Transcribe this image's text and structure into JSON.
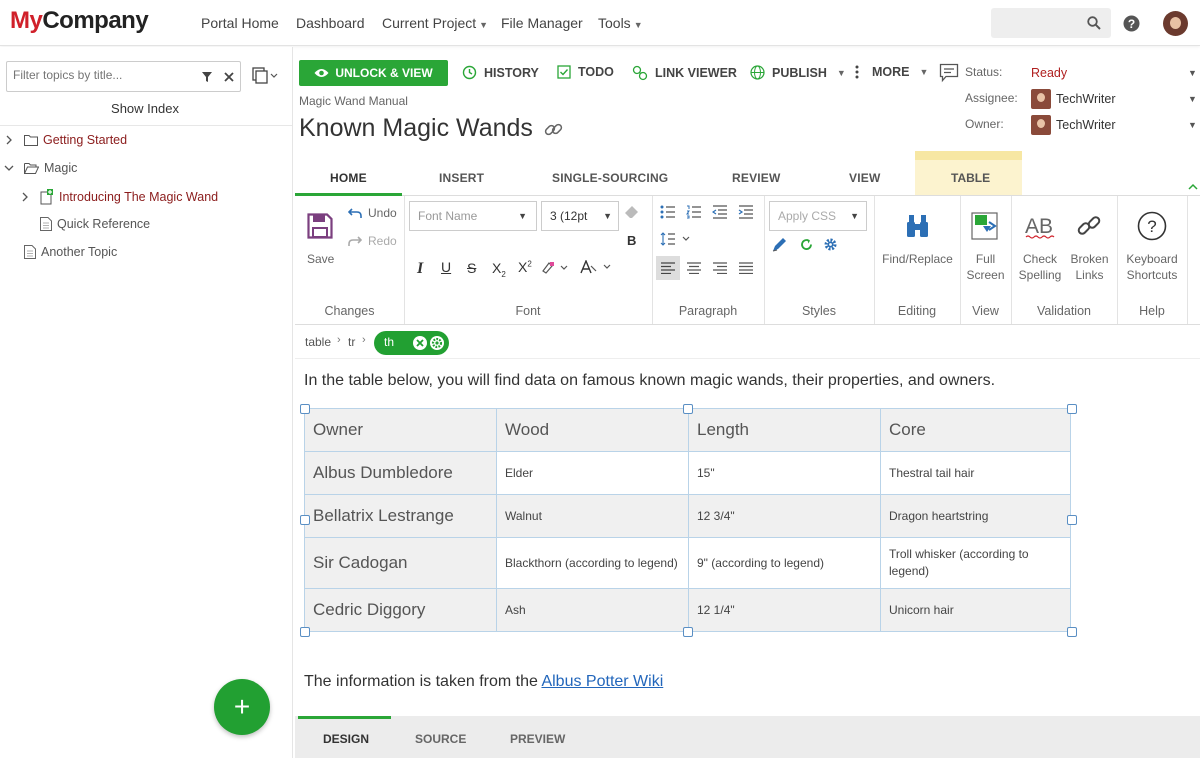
{
  "brand": {
    "my": "My",
    "company": "Company"
  },
  "nav": {
    "items": [
      "Portal Home",
      "Dashboard",
      "Current Project",
      "File Manager",
      "Tools"
    ]
  },
  "left": {
    "filter_placeholder": "Filter topics by title...",
    "show_index": "Show Index",
    "tree": [
      {
        "label": "Getting Started",
        "icon": "folder-icon"
      },
      {
        "label": "Magic",
        "icon": "folder-open-icon"
      },
      {
        "label": "Introducing The Magic Wand",
        "icon": "new-doc-icon"
      },
      {
        "label": "Quick Reference",
        "icon": "doc-icon"
      },
      {
        "label": "Another Topic",
        "icon": "doc-icon"
      }
    ]
  },
  "actions": {
    "unlock": "UNLOCK & VIEW",
    "history": "HISTORY",
    "todo": "TODO",
    "link_viewer": "LINK VIEWER",
    "publish": "PUBLISH",
    "more": "MORE"
  },
  "doc": {
    "crumb": "Magic Wand Manual",
    "title": "Known Magic Wands"
  },
  "meta": {
    "status_label": "Status:",
    "status_value": "Ready",
    "assignee_label": "Assignee:",
    "assignee_value": "TechWriter",
    "owner_label": "Owner:",
    "owner_value": "TechWriter"
  },
  "ribbon_tabs": [
    "HOME",
    "INSERT",
    "SINGLE-SOURCING",
    "REVIEW",
    "VIEW",
    "TABLE"
  ],
  "ribbon": {
    "save": "Save",
    "undo": "Undo",
    "redo": "Redo",
    "font_name": "Font Name",
    "font_size": "3 (12pt",
    "apply_css": "Apply CSS",
    "find_replace": "Find/Replace",
    "full_screen_1": "Full",
    "full_screen_2": "Screen",
    "check_spelling_1": "Check",
    "check_spelling_2": "Spelling",
    "broken_links_1": "Broken",
    "broken_links_2": "Links",
    "keyboard_1": "Keyboard",
    "keyboard_2": "Shortcuts",
    "groups": {
      "changes": "Changes",
      "font": "Font",
      "paragraph": "Paragraph",
      "styles": "Styles",
      "editing": "Editing",
      "view": "View",
      "validation": "Validation",
      "help": "Help"
    }
  },
  "path": [
    "table",
    "tr",
    "th"
  ],
  "editor": {
    "intro": "In the table below, you will find data on famous known magic wands, their properties, and owners.",
    "footnote_prefix": "The information is taken from the ",
    "footnote_link": "Albus Potter Wiki"
  },
  "table": {
    "headers": [
      "Owner",
      "Wood",
      "Length",
      "Core"
    ],
    "rows": [
      [
        "Albus Dumbledore",
        "Elder",
        "15\"",
        "Thestral tail hair"
      ],
      [
        "Bellatrix Lestrange",
        "Walnut",
        "12 3/4\"",
        "Dragon heartstring"
      ],
      [
        "Sir Cadogan",
        "Blackthorn (according to legend)",
        "9\" (according to legend)",
        "Troll whisker (according to legend)"
      ],
      [
        "Cedric Diggory",
        "Ash",
        "12 1/4\"",
        "Unicorn hair"
      ]
    ]
  },
  "bottom_tabs": [
    "DESIGN",
    "SOURCE",
    "PREVIEW"
  ],
  "colors": {
    "accent_green": "#2aa637",
    "brand_red": "#d0202a",
    "table_tab_bg": "#fcf3cf",
    "link_blue": "#2266bb"
  }
}
